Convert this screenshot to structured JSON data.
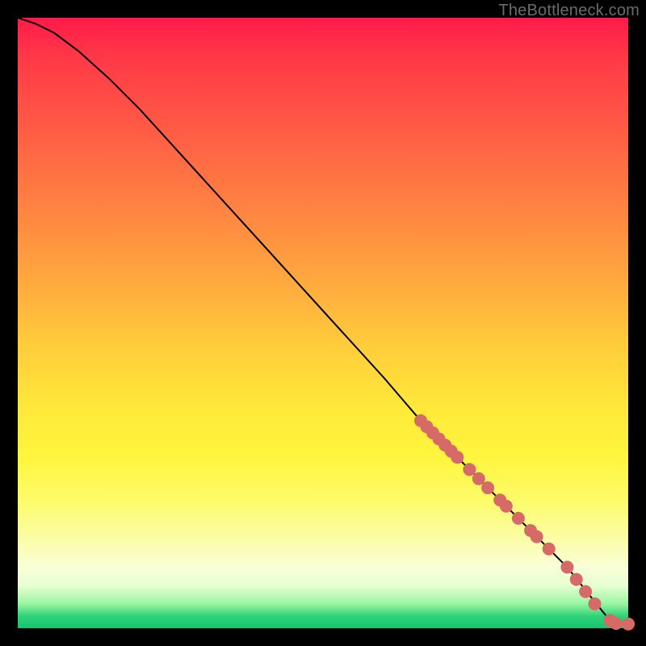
{
  "watermark": "TheBottleneck.com",
  "colors": {
    "line": "#000000",
    "marker_fill": "#d66a66",
    "marker_stroke": "#b45750"
  },
  "chart_data": {
    "type": "line",
    "title": "",
    "xlabel": "",
    "ylabel": "",
    "xlim": [
      0,
      100
    ],
    "ylim": [
      0,
      100
    ],
    "grid": false,
    "legend": false,
    "series": [
      {
        "name": "curve",
        "x": [
          0,
          3,
          6,
          10,
          15,
          20,
          30,
          40,
          50,
          60,
          66,
          68,
          70,
          72,
          74,
          76,
          78,
          80,
          82,
          84,
          86,
          88,
          90,
          92,
          94,
          96,
          97,
          98,
          99,
          100
        ],
        "y": [
          100,
          99,
          97.5,
          94.5,
          90,
          85,
          74,
          63,
          52,
          41,
          34,
          32,
          30,
          28,
          26,
          24,
          22,
          20,
          18,
          16,
          14,
          12,
          10,
          7.5,
          5,
          2.5,
          1.3,
          0.8,
          0.7,
          0.7
        ]
      }
    ],
    "markers": [
      {
        "x": 66,
        "y": 34
      },
      {
        "x": 67,
        "y": 33
      },
      {
        "x": 68,
        "y": 32
      },
      {
        "x": 69,
        "y": 31
      },
      {
        "x": 70,
        "y": 30
      },
      {
        "x": 71,
        "y": 29
      },
      {
        "x": 72,
        "y": 28
      },
      {
        "x": 74,
        "y": 26
      },
      {
        "x": 75.5,
        "y": 24.5
      },
      {
        "x": 77,
        "y": 23
      },
      {
        "x": 79,
        "y": 21
      },
      {
        "x": 80,
        "y": 20
      },
      {
        "x": 82,
        "y": 18
      },
      {
        "x": 84,
        "y": 16
      },
      {
        "x": 85,
        "y": 15
      },
      {
        "x": 87,
        "y": 13
      },
      {
        "x": 90,
        "y": 10
      },
      {
        "x": 91.5,
        "y": 8
      },
      {
        "x": 93,
        "y": 6
      },
      {
        "x": 94.5,
        "y": 4
      },
      {
        "x": 97,
        "y": 1.3
      },
      {
        "x": 98,
        "y": 0.8
      },
      {
        "x": 100,
        "y": 0.7
      }
    ]
  }
}
